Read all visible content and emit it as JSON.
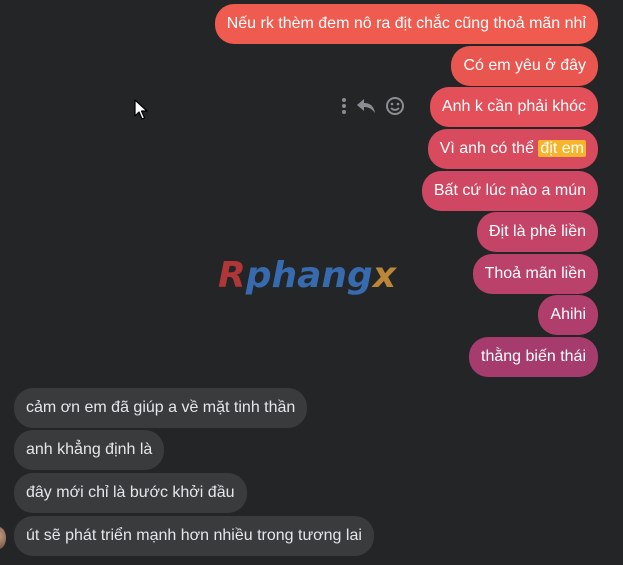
{
  "messages_sent": [
    {
      "text": "Nếu rk thèm đem nô ra địt chắc cũng thoả mãn nhỉ",
      "color": "#ef5b4f"
    },
    {
      "text": "Có em yêu ở đây",
      "color": "#e9554f"
    },
    {
      "text": "Anh k cần phải khóc",
      "color": "#e4505a"
    },
    {
      "text_plain": "Vì anh có thể ",
      "text_highlight": "địt em",
      "color": "#d84a5d"
    },
    {
      "text": "Bất cứ lúc nào a mún",
      "color": "#cf4762"
    },
    {
      "text": "Địt là phê liền",
      "color": "#c44467"
    },
    {
      "text": "Thoả mãn liền",
      "color": "#ba4169"
    },
    {
      "text": "Ahihi",
      "color": "#b03e6c"
    },
    {
      "text": "thằng biến thái",
      "color": "#a63b6e"
    }
  ],
  "messages_received": [
    {
      "text": "cảm ơn em đã giúp a về mặt tinh thần"
    },
    {
      "text": "anh khẳng định là"
    },
    {
      "text": "đây mới chỉ là bước khởi đầu"
    },
    {
      "text": "út sẽ phát triển mạnh hơn nhiều trong tương lai"
    }
  ],
  "message_actions": {
    "icons": [
      "more-vertical-icon",
      "reply-icon",
      "emoji-react-icon"
    ]
  },
  "watermark": {
    "r": "R",
    "mid": "phang",
    "x": "x"
  }
}
